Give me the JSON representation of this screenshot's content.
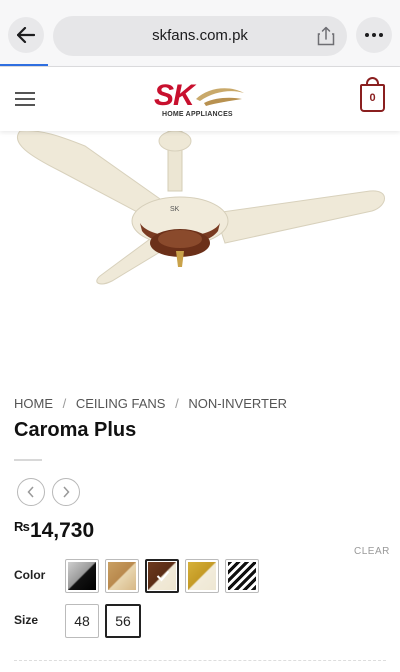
{
  "browser": {
    "url": "skfans.com.pk",
    "back_icon": "arrow-left-icon",
    "share_icon": "share-icon",
    "more_icon": "ellipsis-icon"
  },
  "header": {
    "logo_text": "SK",
    "logo_subtitle": "HOME APPLIANCES",
    "cart_count": "0",
    "menu_icon": "hamburger-icon",
    "colors": {
      "brand_red": "#c8102e",
      "cart_maroon": "#8a1f1f"
    }
  },
  "breadcrumb": {
    "items": [
      "HOME",
      "CEILING FANS",
      "NON-INVERTER"
    ],
    "separator": "/"
  },
  "product": {
    "title": "Caroma Plus",
    "price_currency": "₨",
    "price_amount": "14,730",
    "image_icon": "ceiling-fan-image"
  },
  "navigation": {
    "prev_icon": "chevron-left-icon",
    "next_icon": "chevron-right-icon"
  },
  "options": {
    "clear_label": "CLEAR",
    "color_label": "Color",
    "size_label": "Size",
    "colors": [
      {
        "name": "silver-black",
        "selected": false
      },
      {
        "name": "gold-brown",
        "selected": false
      },
      {
        "name": "brown-cream",
        "selected": true
      },
      {
        "name": "gold-cream",
        "selected": false
      },
      {
        "name": "black-white-striped",
        "selected": false
      }
    ],
    "sizes": [
      {
        "label": "48",
        "selected": false
      },
      {
        "label": "56",
        "selected": true
      }
    ]
  }
}
